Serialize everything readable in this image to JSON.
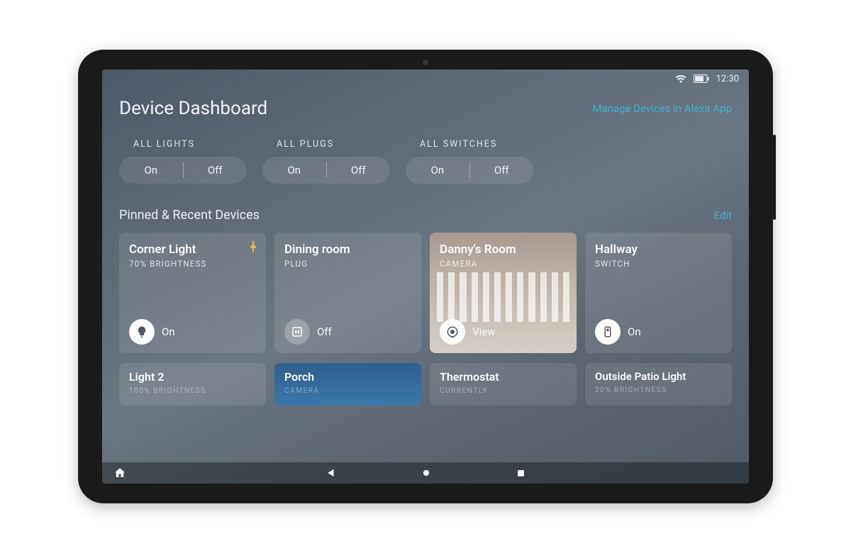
{
  "status": {
    "time": "12:30"
  },
  "header": {
    "title": "Device Dashboard",
    "manage_link": "Manage Devices in Alexa App"
  },
  "groups": [
    {
      "label": "ALL LIGHTS",
      "on": "On",
      "off": "Off"
    },
    {
      "label": "ALL PLUGS",
      "on": "On",
      "off": "Off"
    },
    {
      "label": "ALL SWITCHES",
      "on": "On",
      "off": "Off"
    }
  ],
  "section": {
    "title": "Pinned & Recent Devices",
    "edit": "Edit"
  },
  "cards": [
    {
      "title": "Corner Light",
      "sub": "70% BRIGHTNESS",
      "foot": "On",
      "icon": "bulb",
      "pinned": true
    },
    {
      "title": "Dining room",
      "sub": "PLUG",
      "foot": "Off",
      "icon": "plug",
      "pinned": false
    },
    {
      "title": "Danny's Room",
      "sub": "CAMERA",
      "foot": "View",
      "icon": "camera",
      "pinned": false
    },
    {
      "title": "Hallway",
      "sub": "SWITCH",
      "foot": "On",
      "icon": "switch",
      "pinned": false
    }
  ],
  "cards2": [
    {
      "title": "Light 2",
      "sub": "100% BRIGHTNESS"
    },
    {
      "title": "Porch",
      "sub": "CAMERA"
    },
    {
      "title": "Thermostat",
      "sub": "CURRENTLY"
    },
    {
      "title": "Outside Patio Light",
      "sub": "20% BRIGHTNESS"
    }
  ]
}
